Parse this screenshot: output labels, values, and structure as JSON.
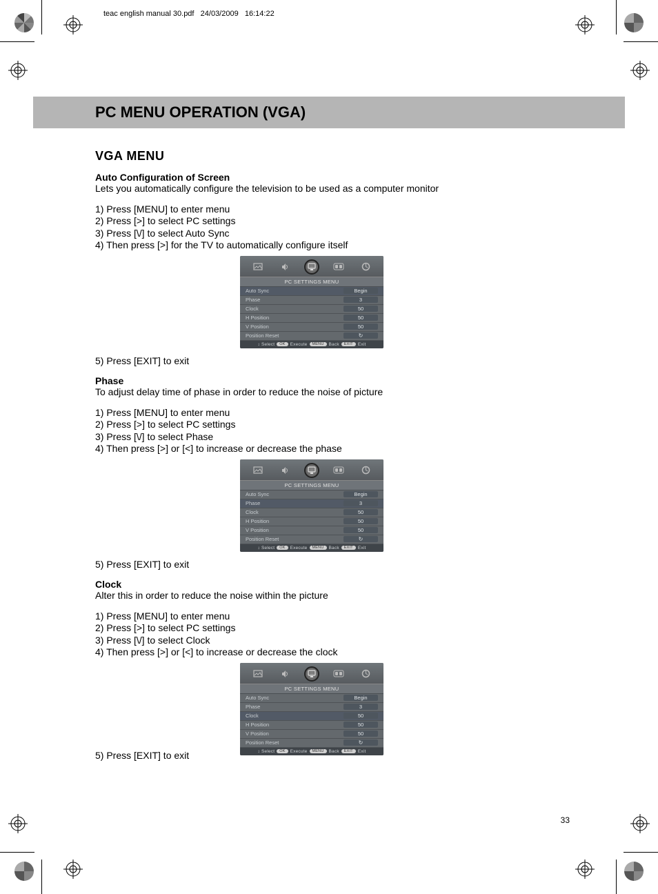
{
  "header": {
    "filename": "teac english manual 30.pdf",
    "date": "24/03/2009",
    "time": "16:14:22"
  },
  "page": {
    "title": "PC MENU OPERATION (VGA)",
    "section": "VGA MENU",
    "number": "33"
  },
  "sections": [
    {
      "heading": "Auto Configuration of Screen",
      "desc": "Lets you automatically configure the television to be used as a computer monitor",
      "steps": [
        "1) Press [MENU] to enter menu",
        "2) Press [>] to select PC settings",
        "3) Press [\\/] to select Auto Sync",
        "4) Then press [>] for the TV to automatically configure itself"
      ],
      "exit": "5) Press [EXIT] to exit"
    },
    {
      "heading": "Phase",
      "desc": "To adjust delay time of phase in order to reduce the noise of picture",
      "steps": [
        "1) Press [MENU] to enter menu",
        "2) Press [>] to select PC settings",
        "3) Press [\\/] to select Phase",
        "4) Then press [>] or [<] to increase or decrease the phase"
      ],
      "exit": "5) Press [EXIT] to exit"
    },
    {
      "heading": "Clock",
      "desc": "Alter this in order to reduce the noise within the picture",
      "steps": [
        "1) Press [MENU] to enter menu",
        "2) Press [>] to select PC settings",
        "3) Press [\\/] to select Clock",
        "4) Then press [>] or [<] to increase or decrease the clock"
      ],
      "exit": "5) Press [EXIT] to exit"
    }
  ],
  "osd": {
    "title": "PC  SETTINGS MENU",
    "rows": [
      {
        "label": "Auto Sync",
        "value": "Begin"
      },
      {
        "label": "Phase",
        "value": "3"
      },
      {
        "label": "Clock",
        "value": "50"
      },
      {
        "label": "H Position",
        "value": "50"
      },
      {
        "label": "V Position",
        "value": "50"
      },
      {
        "label": "Position Reset",
        "value": "↻"
      }
    ],
    "footer": {
      "select": "Select",
      "ok": "OK",
      "execute": "Execute",
      "menu": "MENU",
      "back": "Back",
      "exit_pill": "EXIT",
      "exit": "Exit"
    },
    "highlight": [
      0,
      1,
      2
    ]
  }
}
